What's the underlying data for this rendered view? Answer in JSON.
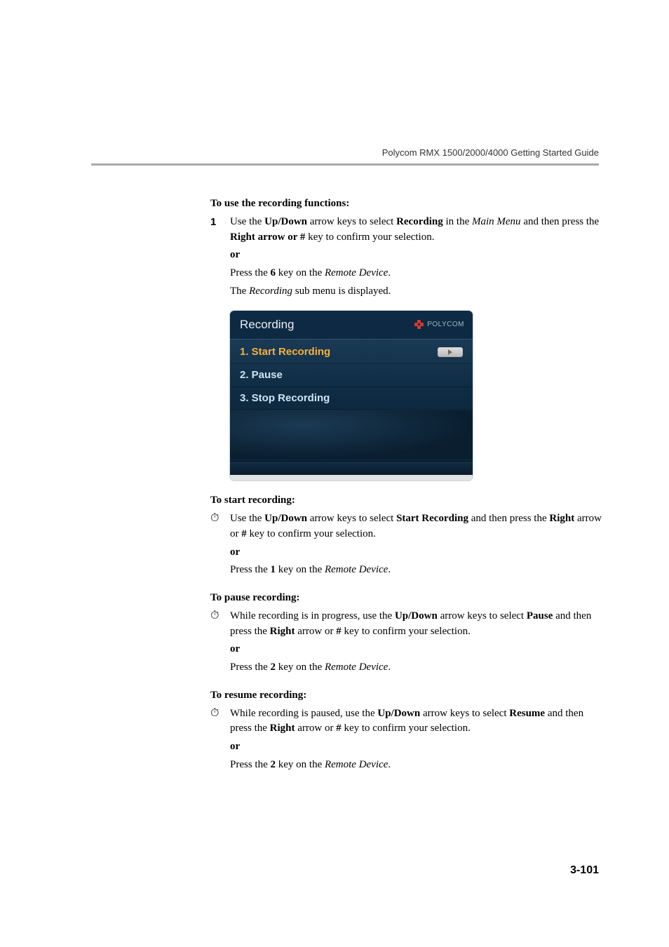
{
  "header": {
    "running_title": "Polycom RMX 1500/2000/4000 Getting Started Guide"
  },
  "page_number": "3-101",
  "sections": {
    "use_title": "To use the recording functions:",
    "step1_num": "1",
    "step1_a": "Use the ",
    "step1_b": "Up/Down",
    "step1_c": " arrow keys to select ",
    "step1_d": "Recording",
    "step1_e": " in the ",
    "step1_f": "Main Menu",
    "step1_g": " and then press the ",
    "step1_h": "Right arrow or #",
    "step1_i": " key to confirm your selection.",
    "or": "or",
    "press6_a": "Press the ",
    "press6_b": "6",
    "press6_c": " key on the ",
    "press6_d": "Remote Device",
    "press6_e": ".",
    "submenu_a": "The ",
    "submenu_b": "Recording",
    "submenu_c": " sub menu is displayed.",
    "start_title": "To start recording:",
    "start_a": "Use the ",
    "start_b": "Up/Down",
    "start_c": " arrow keys to select ",
    "start_d": "Start Recording",
    "start_e": " and then press the ",
    "start_f": "Right",
    "start_g": " arrow or ",
    "start_h": "#",
    "start_i": " key to confirm your selection.",
    "press1_a": "Press the ",
    "press1_b": "1",
    "press1_c": " key on the ",
    "press1_d": "Remote Device",
    "press1_e": ".",
    "pause_title": "To pause recording:",
    "pause_a": "While recording is in progress, use the ",
    "pause_b": "Up/Down",
    "pause_c": " arrow keys to select ",
    "pause_d": "Pause",
    "pause_e": " and then press the ",
    "pause_f": "Right",
    "pause_g": " arrow or ",
    "pause_h": "#",
    "pause_i": " key to confirm your selection.",
    "press2_a": "Press the ",
    "press2_b": "2",
    "press2_c": " key on the ",
    "press2_d": "Remote Device",
    "press2_e": ".",
    "resume_title": "To resume recording:",
    "resume_a": "While recording is paused, use the ",
    "resume_b": "Up/Down",
    "resume_c": " arrow keys to select ",
    "resume_d": "Resume",
    "resume_e": " and then press the ",
    "resume_f": "Right",
    "resume_g": " arrow or ",
    "resume_h": "#",
    "resume_i": " key to confirm your selection.",
    "press2b_a": "Press the ",
    "press2b_b": "2",
    "press2b_c": " key on the ",
    "press2b_d": "Remote Device",
    "press2b_e": "."
  },
  "screenshot": {
    "title": "Recording",
    "brand": "POLYCOM",
    "items": {
      "i1": "1. Start Recording",
      "i2": "2. Pause",
      "i3": "3. Stop Recording"
    }
  },
  "icons": {
    "clock": "⏱"
  }
}
